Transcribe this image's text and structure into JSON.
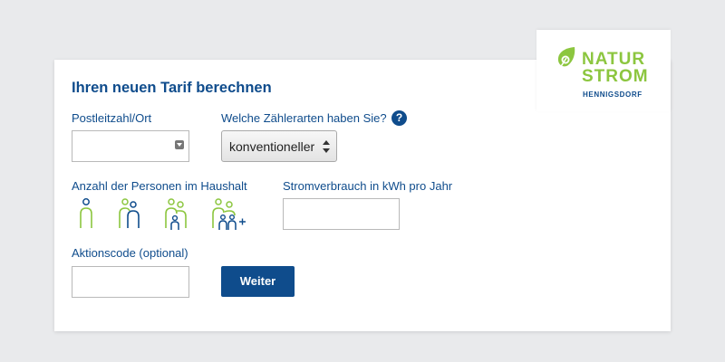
{
  "logo": {
    "line1": "NATUR",
    "line2": "STROM",
    "sub": "HENNIGSDORF",
    "icon": "leaf-icon"
  },
  "form": {
    "title": "Ihren neuen Tarif berechnen",
    "postcode_label": "Postleitzahl/Ort",
    "postcode_value": "",
    "meter_label": "Welche Zählerarten haben Sie?",
    "meter_selected": "konventioneller",
    "help_glyph": "?",
    "persons_label": "Anzahl der Personen im Haushalt",
    "persons_options": [
      "1",
      "2",
      "3",
      "4+"
    ],
    "consumption_label": "Stromverbrauch in kWh pro Jahr",
    "consumption_value": "",
    "promo_label": "Aktionscode (optional)",
    "promo_value": "",
    "submit_label": "Weiter"
  },
  "colors": {
    "brand_blue": "#0f4c8c",
    "brand_green": "#8cc63f",
    "background": "#e9eaec"
  }
}
